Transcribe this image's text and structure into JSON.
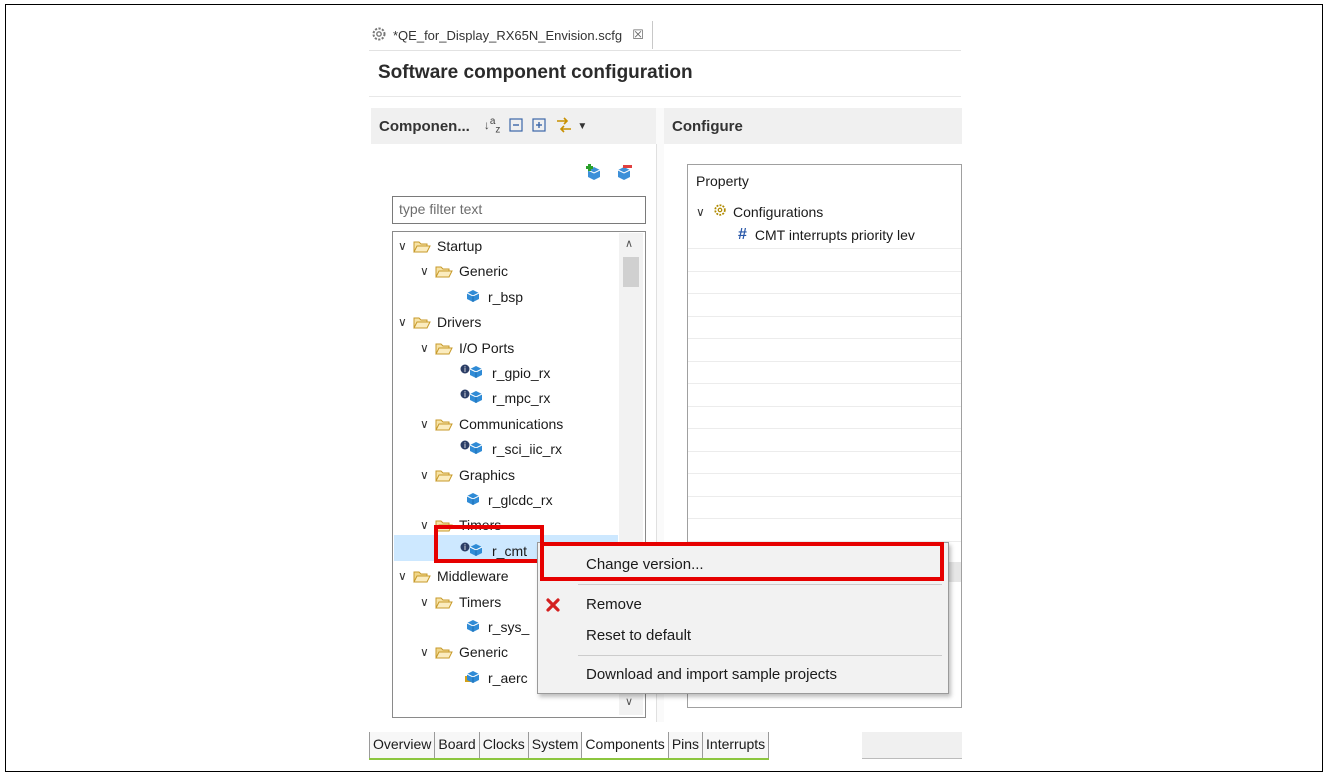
{
  "editor": {
    "tab_title": "*QE_for_Display_RX65N_Envision.scfg",
    "tab_close": "☒",
    "page_title": "Software component configuration"
  },
  "components_panel": {
    "title": "Componen...",
    "filter_placeholder": "type filter text",
    "tree": [
      {
        "label": "Startup",
        "type": "folder",
        "level": 0
      },
      {
        "label": "Generic",
        "type": "folder",
        "level": 1
      },
      {
        "label": "r_bsp",
        "type": "component",
        "level": 2
      },
      {
        "label": "Drivers",
        "type": "folder",
        "level": 0
      },
      {
        "label": "I/O Ports",
        "type": "folder",
        "level": 1
      },
      {
        "label": "r_gpio_rx",
        "type": "component-info",
        "level": 2
      },
      {
        "label": "r_mpc_rx",
        "type": "component-info",
        "level": 2
      },
      {
        "label": "Communications",
        "type": "folder",
        "level": 1
      },
      {
        "label": "r_sci_iic_rx",
        "type": "component-info",
        "level": 2
      },
      {
        "label": "Graphics",
        "type": "folder",
        "level": 1
      },
      {
        "label": "r_glcdc_rx",
        "type": "component",
        "level": 2
      },
      {
        "label": "Timers",
        "type": "folder",
        "level": 1
      },
      {
        "label": "r_cmt",
        "type": "component-info",
        "level": 2
      },
      {
        "label": "Middleware",
        "type": "folder-special",
        "level": 0
      },
      {
        "label": "Timers",
        "type": "folder",
        "level": 1
      },
      {
        "label": "r_sys_",
        "type": "component",
        "level": 2
      },
      {
        "label": "Generic",
        "type": "folder-special",
        "level": 1
      },
      {
        "label": "r_aerc",
        "type": "component-locked",
        "level": 2
      }
    ]
  },
  "configure_panel": {
    "title": "Configure",
    "column_header": "Property",
    "rows": [
      {
        "label": "Configurations"
      },
      {
        "label": "CMT interrupts priority lev"
      }
    ]
  },
  "context_menu": {
    "items": [
      {
        "label": "Change version...",
        "icon": ""
      },
      {
        "label": "Remove",
        "icon": "red-x-icon"
      },
      {
        "label": "Reset to default",
        "icon": ""
      },
      {
        "label": "Download and import sample projects",
        "icon": ""
      }
    ]
  },
  "bottom_tabs": [
    "Overview",
    "Board",
    "Clocks",
    "System",
    "Components",
    "Pins",
    "Interrupts"
  ],
  "active_bottom_tab": "Components",
  "colors": {
    "highlight_red": "#e60000",
    "selection": "#cde8ff",
    "remove_icon": "#d42020"
  }
}
